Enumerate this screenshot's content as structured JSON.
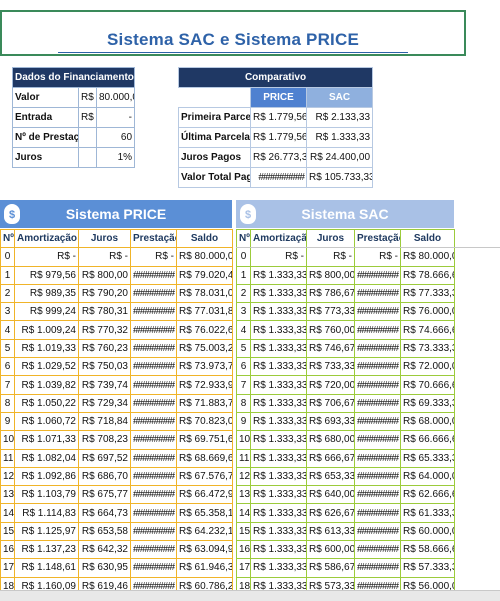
{
  "title": "Sistema SAC e Sistema PRICE",
  "dados": {
    "header": "Dados do Financiamento",
    "rows": [
      {
        "label": "Valor",
        "cur": "R$",
        "value": "80.000,00"
      },
      {
        "label": "Entrada",
        "cur": "R$",
        "value": "-"
      },
      {
        "label": "Nº de Prestações",
        "cur": "",
        "value": "60"
      },
      {
        "label": "Juros",
        "cur": "",
        "value": "1%"
      }
    ]
  },
  "comparativo": {
    "header": "Comparativo",
    "col_price": "PRICE",
    "col_sac": "SAC",
    "rows": [
      {
        "label": "Primeira Parcela",
        "price": "R$ 1.779,56",
        "sac": "R$ 2.133,33"
      },
      {
        "label": "Última Parcela",
        "price": "R$ 1.779,56",
        "sac": "R$ 1.333,33"
      },
      {
        "label": "Juros Pagos",
        "price": "R$ 26.773,35",
        "sac": "R$ 24.400,00"
      },
      {
        "label": "Valor Total Pago",
        "price": "##########",
        "sac": "R$ 105.733,33"
      }
    ]
  },
  "price": {
    "banner": "Sistema PRICE",
    "headers": [
      "Nº",
      "Amortização",
      "Juros",
      "Prestação",
      "Saldo"
    ],
    "rows": [
      [
        "0",
        "R$ -",
        "R$ -",
        "R$ -",
        "R$ 80.000,00"
      ],
      [
        "1",
        "R$ 979,56",
        "R$ 800,00",
        "#########",
        "R$ 79.020,44"
      ],
      [
        "2",
        "R$ 989,35",
        "R$ 790,20",
        "#########",
        "R$ 78.031,09"
      ],
      [
        "3",
        "R$ 999,24",
        "R$ 780,31",
        "#########",
        "R$ 77.031,85"
      ],
      [
        "4",
        "R$ 1.009,24",
        "R$ 770,32",
        "#########",
        "R$ 76.022,61"
      ],
      [
        "5",
        "R$ 1.019,33",
        "R$ 760,23",
        "#########",
        "R$ 75.003,28"
      ],
      [
        "6",
        "R$ 1.029,52",
        "R$ 750,03",
        "#########",
        "R$ 73.973,76"
      ],
      [
        "7",
        "R$ 1.039,82",
        "R$ 739,74",
        "#########",
        "R$ 72.933,94"
      ],
      [
        "8",
        "R$ 1.050,22",
        "R$ 729,34",
        "#########",
        "R$ 71.883,72"
      ],
      [
        "9",
        "R$ 1.060,72",
        "R$ 718,84",
        "#########",
        "R$ 70.823,00"
      ],
      [
        "10",
        "R$ 1.071,33",
        "R$ 708,23",
        "#########",
        "R$ 69.751,68"
      ],
      [
        "11",
        "R$ 1.082,04",
        "R$ 697,52",
        "#########",
        "R$ 68.669,64"
      ],
      [
        "12",
        "R$ 1.092,86",
        "R$ 686,70",
        "#########",
        "R$ 67.576,78"
      ],
      [
        "13",
        "R$ 1.103,79",
        "R$ 675,77",
        "#########",
        "R$ 66.472,99"
      ],
      [
        "14",
        "R$ 1.114,83",
        "R$ 664,73",
        "#########",
        "R$ 65.358,17"
      ],
      [
        "15",
        "R$ 1.125,97",
        "R$ 653,58",
        "#########",
        "R$ 64.232,19"
      ],
      [
        "16",
        "R$ 1.137,23",
        "R$ 642,32",
        "#########",
        "R$ 63.094,96"
      ],
      [
        "17",
        "R$ 1.148,61",
        "R$ 630,95",
        "#########",
        "R$ 61.946,35"
      ],
      [
        "18",
        "R$ 1.160,09",
        "R$ 619,46",
        "#########",
        "R$ 60.786,26"
      ]
    ]
  },
  "sac": {
    "banner": "Sistema SAC",
    "headers": [
      "Nº",
      "Amortização",
      "Juros",
      "Prestação",
      "Saldo"
    ],
    "rows": [
      [
        "0",
        "R$ -",
        "R$ -",
        "R$ -",
        "R$ 80.000,00"
      ],
      [
        "1",
        "R$ 1.333,33",
        "R$ 800,00",
        "#########",
        "R$ 78.666,67"
      ],
      [
        "2",
        "R$ 1.333,33",
        "R$ 786,67",
        "#########",
        "R$ 77.333,33"
      ],
      [
        "3",
        "R$ 1.333,33",
        "R$ 773,33",
        "#########",
        "R$ 76.000,00"
      ],
      [
        "4",
        "R$ 1.333,33",
        "R$ 760,00",
        "#########",
        "R$ 74.666,67"
      ],
      [
        "5",
        "R$ 1.333,33",
        "R$ 746,67",
        "#########",
        "R$ 73.333,33"
      ],
      [
        "6",
        "R$ 1.333,33",
        "R$ 733,33",
        "#########",
        "R$ 72.000,00"
      ],
      [
        "7",
        "R$ 1.333,33",
        "R$ 720,00",
        "#########",
        "R$ 70.666,67"
      ],
      [
        "8",
        "R$ 1.333,33",
        "R$ 706,67",
        "#########",
        "R$ 69.333,33"
      ],
      [
        "9",
        "R$ 1.333,33",
        "R$ 693,33",
        "#########",
        "R$ 68.000,00"
      ],
      [
        "10",
        "R$ 1.333,33",
        "R$ 680,00",
        "#########",
        "R$ 66.666,67"
      ],
      [
        "11",
        "R$ 1.333,33",
        "R$ 666,67",
        "#########",
        "R$ 65.333,33"
      ],
      [
        "12",
        "R$ 1.333,33",
        "R$ 653,33",
        "#########",
        "R$ 64.000,00"
      ],
      [
        "13",
        "R$ 1.333,33",
        "R$ 640,00",
        "#########",
        "R$ 62.666,67"
      ],
      [
        "14",
        "R$ 1.333,33",
        "R$ 626,67",
        "#########",
        "R$ 61.333,33"
      ],
      [
        "15",
        "R$ 1.333,33",
        "R$ 613,33",
        "#########",
        "R$ 60.000,00"
      ],
      [
        "16",
        "R$ 1.333,33",
        "R$ 600,00",
        "#########",
        "R$ 58.666,67"
      ],
      [
        "17",
        "R$ 1.333,33",
        "R$ 586,67",
        "#########",
        "R$ 57.333,33"
      ],
      [
        "18",
        "R$ 1.333,33",
        "R$ 573,33",
        "#########",
        "R$ 56.000,00"
      ]
    ]
  }
}
